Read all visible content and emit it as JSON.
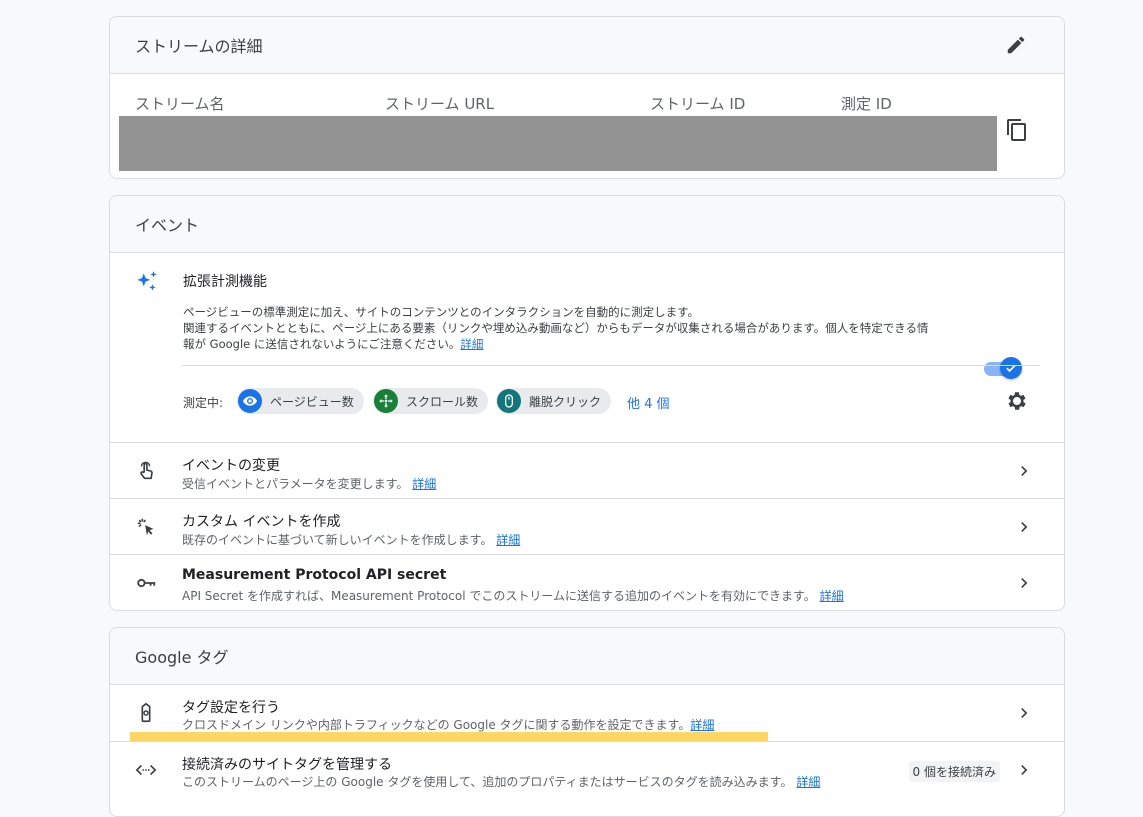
{
  "stream": {
    "title": "ストリームの詳細",
    "col_name": "ストリーム名",
    "col_url": "ストリーム URL",
    "col_id": "ストリーム ID",
    "col_measure": "測定 ID"
  },
  "events": {
    "title": "イベント",
    "enhanced": {
      "title": "拡張計測機能",
      "desc1": "ページビューの標準測定に加え、サイトのコンテンツとのインタラクションを自動的に測定します。",
      "desc2": "関連するイベントとともに、ページ上にある要素（リンクや埋め込み動画など）からもデータが収集される場合があります。個人を特定できる情",
      "desc3": "報が Google に送信されないようにご注意ください。",
      "link": "詳細",
      "enabled": true,
      "measuring_label": "測定中:",
      "chips": [
        {
          "label": "ページビュー数",
          "icon": "eye-icon",
          "color": "#1a73e8"
        },
        {
          "label": "スクロール数",
          "icon": "crosshair-arrows-icon",
          "color": "#188038"
        },
        {
          "label": "離脱クリック",
          "icon": "mouse-icon",
          "color": "#12767b"
        }
      ],
      "more": "他 4 個"
    },
    "rows": [
      {
        "title": "イベントの変更",
        "sub": "受信イベントとパラメータを変更します。",
        "link": "詳細"
      },
      {
        "title": "カスタム イベントを作成",
        "sub": "既存のイベントに基づいて新しいイベントを作成します。",
        "link": "詳細"
      },
      {
        "title": "Measurement Protocol API secret",
        "sub": "API Secret を作成すれば、Measurement Protocol でこのストリームに送信する追加のイベントを有効にできます。",
        "link": "詳細"
      }
    ]
  },
  "gtag": {
    "title": "Google タグ",
    "rows": [
      {
        "title": "タグ設定を行う",
        "sub": "クロスドメイン リンクや内部トラフィックなどの Google タグに関する動作を設定できます。",
        "link": "詳細"
      },
      {
        "title": "接続済みのサイトタグを管理する",
        "sub": "このストリームのページ上の Google タグを使用して、追加のプロパティまたはサービスのタグを読み込みます。",
        "link": "詳細",
        "badge": "0 個を接続済み"
      }
    ]
  },
  "colors": {
    "accent": "#1a73e8",
    "highlight": "#fdd663",
    "redacted": "#939393"
  }
}
